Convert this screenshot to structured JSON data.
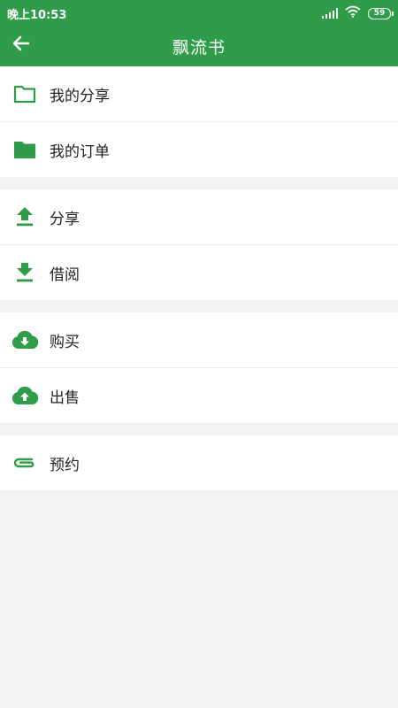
{
  "status": {
    "time": "晚上10:53",
    "battery": "59"
  },
  "header": {
    "title": "飘流书",
    "back_icon": "arrow-left-icon"
  },
  "colors": {
    "brand": "#2e9c48",
    "background": "#f2f2f2"
  },
  "groups": [
    {
      "items": [
        {
          "label": "我的分享",
          "icon": "folder-outline-icon"
        },
        {
          "label": "我的订单",
          "icon": "folder-filled-icon"
        }
      ]
    },
    {
      "items": [
        {
          "label": "分享",
          "icon": "upload-icon"
        },
        {
          "label": "借阅",
          "icon": "download-icon"
        }
      ]
    },
    {
      "items": [
        {
          "label": "购买",
          "icon": "cloud-download-icon"
        },
        {
          "label": "出售",
          "icon": "cloud-upload-icon"
        }
      ]
    },
    {
      "items": [
        {
          "label": "预约",
          "icon": "paperclip-icon"
        }
      ]
    }
  ]
}
